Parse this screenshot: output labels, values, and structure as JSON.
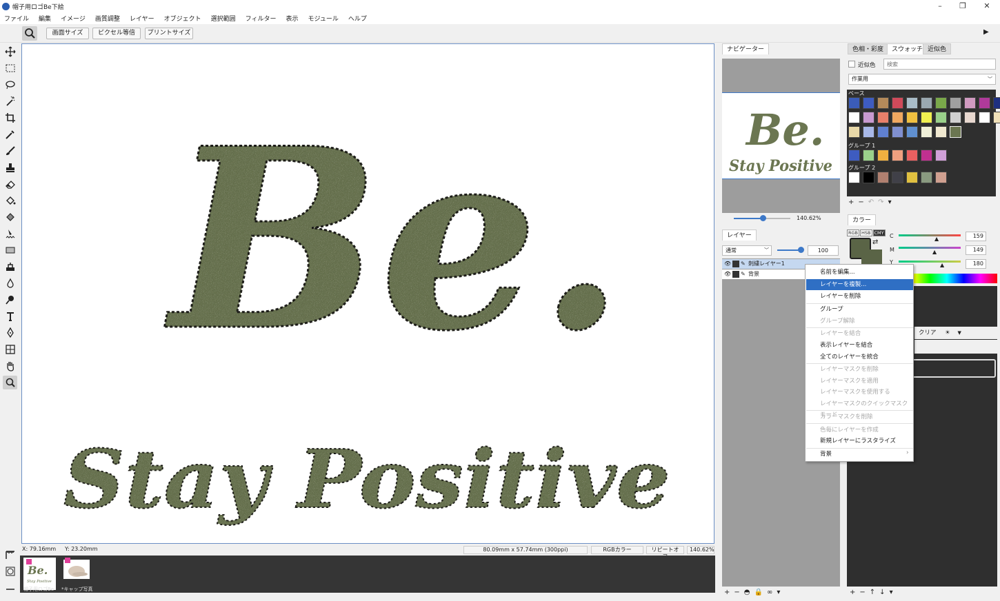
{
  "window": {
    "title": "帽子用ロゴBe下絵"
  },
  "menu": [
    "ファイル",
    "編集",
    "イメージ",
    "画質調整",
    "レイヤー",
    "オブジェクト",
    "選択範囲",
    "フィルター",
    "表示",
    "モジュール",
    "ヘルプ"
  ],
  "toolbar": {
    "buttons": [
      "画面サイズ",
      "ピクセル等倍",
      "プリントサイズ"
    ]
  },
  "canvas": {
    "art_line1": "Be.",
    "art_line2": "Stay Positive",
    "color": "#6b7651"
  },
  "status": {
    "x_label": "X:",
    "x_value": "79.16mm",
    "y_label": "Y:",
    "y_value": "23.20mm",
    "size": "80.09mm x 57.74mm (300ppi)",
    "mode": "RGBカラー",
    "repeat": "リピートオフ",
    "zoom": "140.62%"
  },
  "thumbnails": [
    {
      "label": "帽子用ロゴBe",
      "active": true
    },
    {
      "label": "*キャップ写真",
      "active": false
    }
  ],
  "navigator": {
    "tab": "ナビゲーター",
    "zoom": "140.62%",
    "preview_line1": "Be.",
    "preview_line2": "Stay Positive"
  },
  "layers": {
    "tab": "レイヤー",
    "blend_mode": "通常",
    "opacity": "100",
    "items": [
      {
        "name": "刺繍レイヤー1",
        "selected": true
      },
      {
        "name": "背景",
        "selected": false
      }
    ]
  },
  "swatches": {
    "tabs": [
      "色相・彩度",
      "スウォッチ",
      "近似色"
    ],
    "near_color_label": "近似色",
    "search_placeholder": "検索",
    "set": "作業用",
    "groups": [
      {
        "name": "ベース",
        "colors": [
          "#3b5cb8",
          "#3e5cc0",
          "#b48a5a",
          "#d04a5a",
          "#a9bcc8",
          "#9aa8b0",
          "#7aa84a",
          "#a0a0a0",
          "#d09ac0",
          "#b03a9a",
          "#1e3080",
          "#ffffff",
          "#c89ad0",
          "#e8806a",
          "#f0a860",
          "#f0c040",
          "#f0f050",
          "#9ad08a",
          "#d0d0d0",
          "#e8d8d0",
          "#ffffff",
          "#f0e0b8",
          "#e8d8a8",
          "#a8b8e8",
          "#6080d0",
          "#8090d0",
          "#6090d0",
          "#f0f0d8",
          "#f0e8d0",
          "#6b7651"
        ]
      },
      {
        "name": "グループ 1",
        "colors": [
          "#3e5cc0",
          "#9ad08a",
          "#f0b040",
          "#f0a080",
          "#e86060",
          "#c03090",
          "#d0a0d8"
        ]
      },
      {
        "name": "グループ 2",
        "colors": [
          "#ffffff",
          "#000000",
          "#b08070",
          "#404048",
          "#e0c040",
          "#8a9a80",
          "#d0a090"
        ]
      }
    ]
  },
  "color": {
    "tab": "カラー",
    "modes": [
      "RGB",
      "HSB",
      "CMY"
    ],
    "active_mode": "CMY",
    "foreground": "#5a6446",
    "channels": [
      {
        "name": "C",
        "value": "159"
      },
      {
        "name": "M",
        "value": "149"
      },
      {
        "name": "Y",
        "value": "180"
      }
    ],
    "clear_label": "クリア"
  },
  "context_menu": {
    "items": [
      {
        "label": "名前を編集...",
        "state": "normal"
      },
      {
        "label": "レイヤーを複製...",
        "state": "active"
      },
      {
        "label": "レイヤーを削除",
        "state": "normal"
      },
      {
        "label": "グループ",
        "state": "normal"
      },
      {
        "label": "グループ解除",
        "state": "disabled"
      },
      {
        "label": "レイヤーを結合",
        "state": "disabled"
      },
      {
        "label": "表示レイヤーを結合",
        "state": "normal"
      },
      {
        "label": "全てのレイヤーを統合",
        "state": "normal"
      },
      {
        "label": "レイヤーマスクを削除",
        "state": "disabled"
      },
      {
        "label": "レイヤーマスクを適用",
        "state": "disabled"
      },
      {
        "label": "レイヤーマスクを使用する",
        "state": "disabled"
      },
      {
        "label": "レイヤーマスクのクイックマスクモード",
        "state": "disabled"
      },
      {
        "label": "カラーマスクを削除",
        "state": "disabled"
      },
      {
        "label": "色毎にレイヤーを作成",
        "state": "disabled"
      },
      {
        "label": "新規レイヤーにラスタライズ",
        "state": "normal"
      },
      {
        "label": "背景",
        "state": "submenu"
      }
    ]
  }
}
